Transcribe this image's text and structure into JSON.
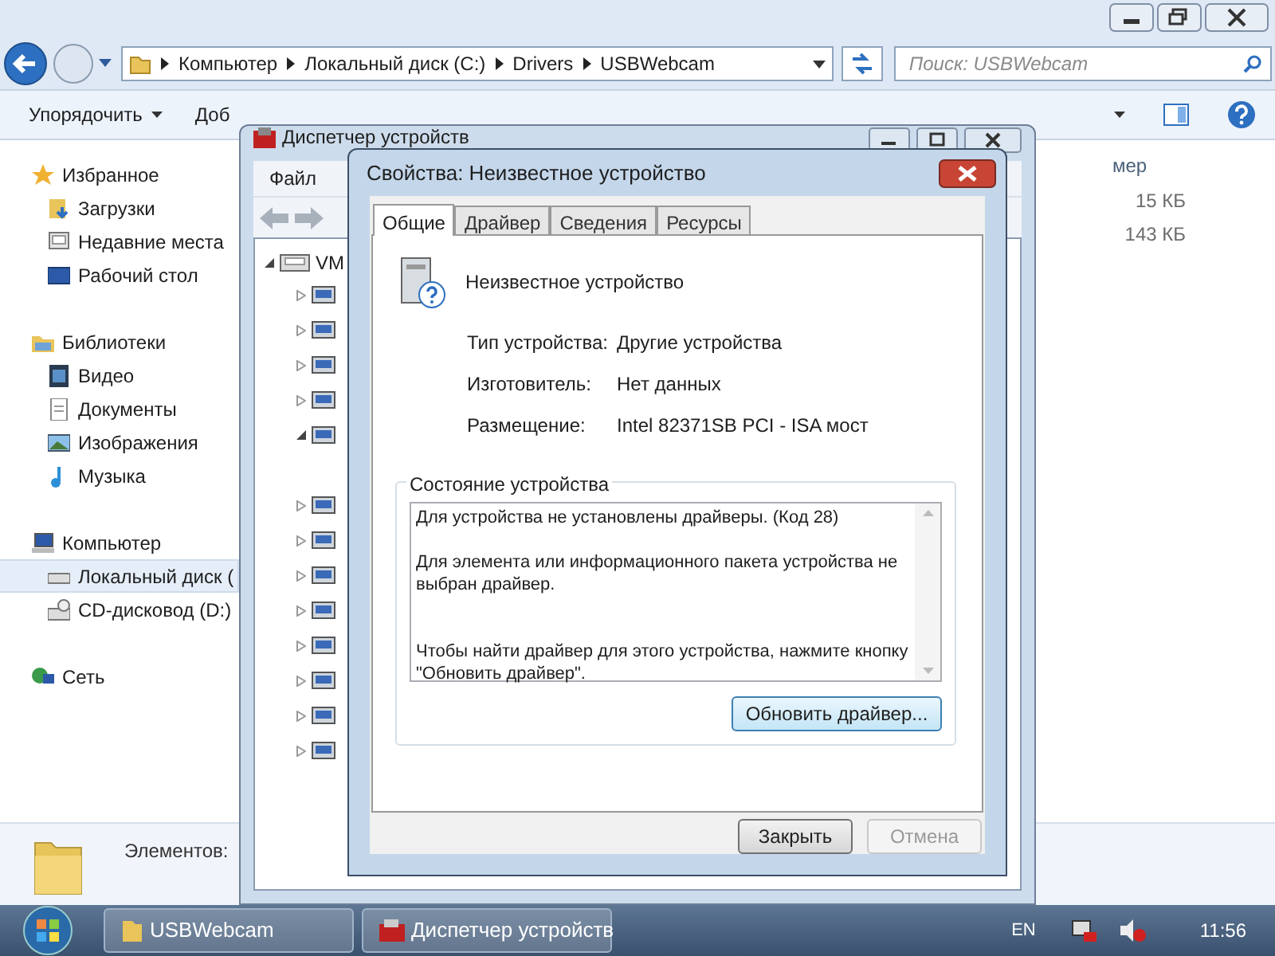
{
  "explorer": {
    "address": [
      "Компьютер",
      "Локальный диск (C:)",
      "Drivers",
      "USBWebcam"
    ],
    "search": {
      "placeholder": "Поиск: USBWebcam"
    },
    "toolbar": [
      "Упорядочить",
      "Доб"
    ],
    "nav_pane": [
      {
        "label": "Избранное",
        "kind": "favorites",
        "selected": false,
        "children": [
          {
            "label": "Загрузки",
            "kind": "downloads",
            "selected": false
          },
          {
            "label": "Недавние места",
            "kind": "recent",
            "selected": false
          },
          {
            "label": "Рабочий стол",
            "kind": "desktop",
            "selected": false
          }
        ]
      },
      {
        "label": "Библиотеки",
        "kind": "libraries",
        "selected": false,
        "children": [
          {
            "label": "Видео",
            "kind": "video",
            "selected": false
          },
          {
            "label": "Документы",
            "kind": "documents",
            "selected": false
          },
          {
            "label": "Изображения",
            "kind": "pictures",
            "selected": false
          },
          {
            "label": "Музыка",
            "kind": "music",
            "selected": false
          }
        ]
      },
      {
        "label": "Компьютер",
        "kind": "computer",
        "selected": false,
        "children": [
          {
            "label": "Локальный диск (",
            "kind": "disk",
            "selected": true
          },
          {
            "label": "CD-дисковод (D:)",
            "kind": "cd",
            "selected": false
          }
        ]
      },
      {
        "label": "Сеть",
        "kind": "network",
        "selected": false
      }
    ],
    "column_header": "мер",
    "sizes": [
      "15 КБ",
      "143 КБ"
    ],
    "status": "Элементов:"
  },
  "device_manager": {
    "title": "Диспетчер устройств",
    "menu": [
      "Файл"
    ],
    "tree": {
      "label": "VM",
      "expanded": true,
      "children": [
        {
          "expanded": false
        },
        {
          "expanded": false
        },
        {
          "expanded": false
        },
        {
          "expanded": false
        },
        {
          "expanded": true
        },
        {
          "expanded": false
        },
        {
          "expanded": false
        },
        {
          "expanded": false
        },
        {
          "expanded": false
        },
        {
          "expanded": false
        },
        {
          "expanded": false
        },
        {
          "expanded": false
        },
        {
          "expanded": false
        }
      ]
    }
  },
  "dialog": {
    "title": "Свойства: Неизвестное устройство",
    "tabs": [
      {
        "label": "Общие",
        "selected": true
      },
      {
        "label": "Драйвер",
        "selected": false
      },
      {
        "label": "Сведения",
        "selected": false
      },
      {
        "label": "Ресурсы",
        "selected": false
      }
    ],
    "device_name": "Неизвестное устройство",
    "properties": [
      {
        "label": "Тип устройства:",
        "value": "Другие устройства"
      },
      {
        "label": "Изготовитель:",
        "value": "Нет данных"
      },
      {
        "label": "Размещение:",
        "value": "Intel 82371SB PCI - ISA мост"
      }
    ],
    "status_group": "Состояние устройства",
    "status_text": [
      "Для устройства не установлены драйверы. (Код 28)",
      "Для элемента или информационного пакета устройства не выбран драйвер.",
      "Чтобы найти драйвер для этого устройства, нажмите кнопку \"Обновить драйвер\"."
    ],
    "update_button": "Обновить драйвер...",
    "buttons": [
      {
        "label": "Закрыть",
        "disabled": false
      },
      {
        "label": "Отмена",
        "disabled": true
      }
    ]
  },
  "taskbar": {
    "tasks": [
      "USBWebcam",
      "Диспетчер устройств"
    ],
    "language": "EN",
    "clock": "11:56"
  }
}
